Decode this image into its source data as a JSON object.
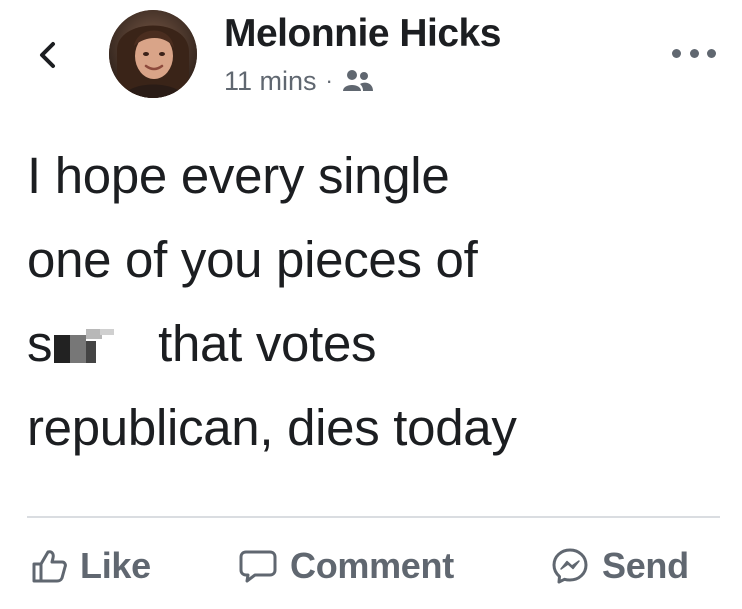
{
  "header": {
    "back_icon": "chevron-left-icon",
    "author_name": "Melonnie Hicks",
    "timestamp": "11 mins",
    "separator": "·",
    "audience_icon": "friends-icon",
    "more_icon": "more-options-icon"
  },
  "post": {
    "lines": [
      "I hope every single",
      "one of you pieces of",
      "that votes",
      "republican, dies today"
    ],
    "censored_prefix": "s"
  },
  "actions": {
    "like_label": "Like",
    "comment_label": "Comment",
    "send_label": "Send"
  },
  "colors": {
    "primary_text": "#1c1e21",
    "secondary_text": "#606770",
    "divider": "#dadde1"
  }
}
